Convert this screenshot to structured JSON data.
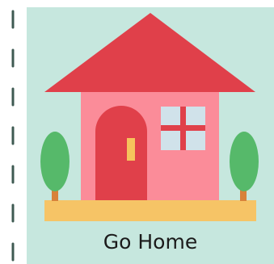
{
  "card": {
    "label": "Go Home",
    "icon": "house-icon"
  },
  "colors": {
    "background": "#c6e7de",
    "roof": "#e0404a",
    "wall": "#fb8c99",
    "door": "#e0404a",
    "door_handle": "#f6c35c",
    "window_glass": "#d0e2ea",
    "window_cross": "#e0404a",
    "ground": "#f6c466",
    "tree_foliage": "#56b96a",
    "tree_trunk": "#d8823a",
    "rail_dash": "#3e5a52"
  }
}
